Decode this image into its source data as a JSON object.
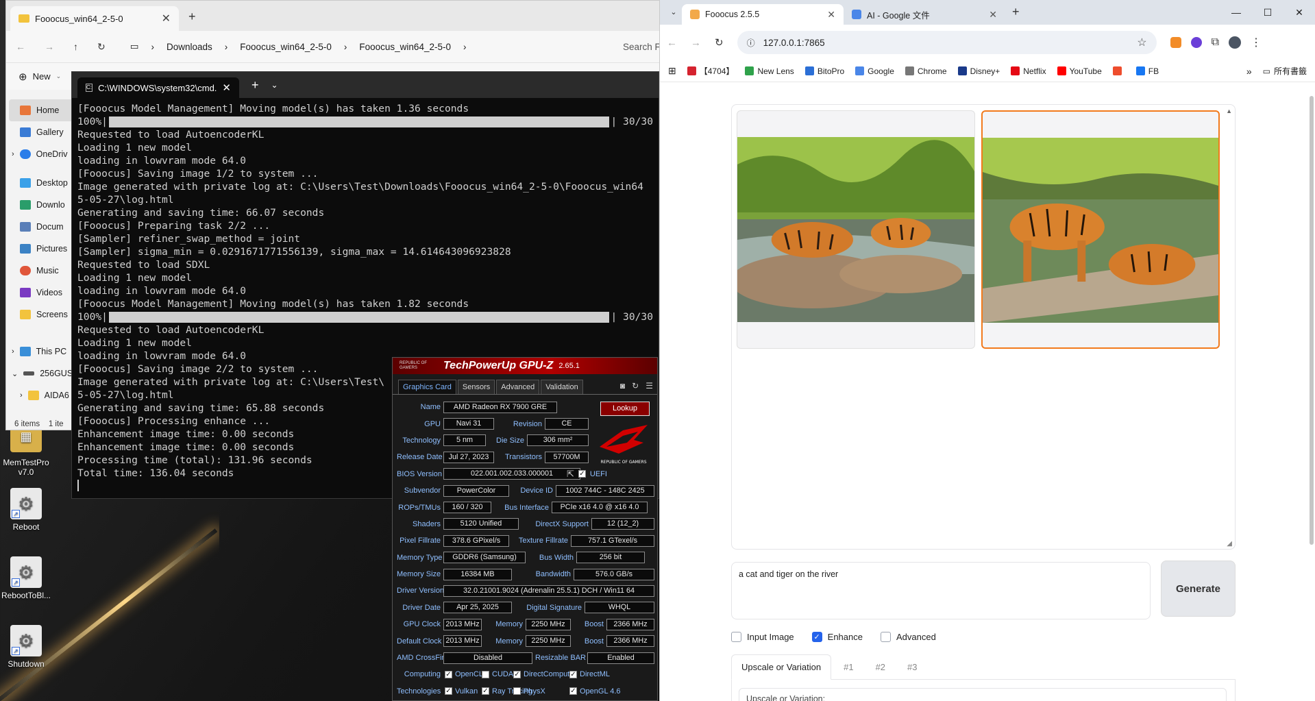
{
  "desktop": {
    "icons": [
      {
        "label": "MemTestPro v7.0"
      },
      {
        "label": "Reboot"
      },
      {
        "label": "RebootToBl..."
      },
      {
        "label": "Shutdown"
      }
    ]
  },
  "explorer": {
    "tab_title": "Fooocus_win64_2-5-0",
    "breadcrumbs": [
      "Downloads",
      "Fooocus_win64_2-5-0",
      "Fooocus_win64_2-5-0"
    ],
    "search_placeholder": "Search Foooc",
    "new_label": "New",
    "sidebar": [
      {
        "label": "Home",
        "color": "#e8763a"
      },
      {
        "label": "Gallery",
        "color": "#3a7bd5"
      },
      {
        "label": "OneDriv",
        "color": "#2b7de9"
      },
      {
        "label": "Desktop",
        "color": "#3aa0e8"
      },
      {
        "label": "Downlo",
        "color": "#2a9d6a"
      },
      {
        "label": "Docum",
        "color": "#5a7fb8"
      },
      {
        "label": "Pictures",
        "color": "#3b82c4"
      },
      {
        "label": "Music",
        "color": "#e0563a"
      },
      {
        "label": "Videos",
        "color": "#7a3ac2"
      },
      {
        "label": "Screens",
        "color": "#f2c33d"
      },
      {
        "label": "This PC",
        "color": "#3a8fd8"
      },
      {
        "label": "256GUS",
        "color": "#555555"
      },
      {
        "label": "AIDA6",
        "color": "#f2c33d"
      }
    ],
    "status": "6 items    1 ite"
  },
  "terminal": {
    "tab_title": "C:\\WINDOWS\\system32\\cmd.",
    "lines": [
      {
        "type": "text",
        "text": "[Fooocus Model Management] Moving model(s) has taken 1.36 seconds"
      },
      {
        "type": "bar",
        "prefix": "100%|",
        "suffix": "| 30/30"
      },
      {
        "type": "text",
        "text": "Requested to load AutoencoderKL"
      },
      {
        "type": "text",
        "text": "Loading 1 new model"
      },
      {
        "type": "text",
        "text": "loading in lowvram mode 64.0"
      },
      {
        "type": "text",
        "text": "[Fooocus] Saving image 1/2 to system ..."
      },
      {
        "type": "text",
        "text": "Image generated with private log at: C:\\Users\\Test\\Downloads\\Fooocus_win64_2-5-0\\Fooocus_win64"
      },
      {
        "type": "text",
        "text": "5-05-27\\log.html"
      },
      {
        "type": "text",
        "text": "Generating and saving time: 66.07 seconds"
      },
      {
        "type": "text",
        "text": "[Fooocus] Preparing task 2/2 ..."
      },
      {
        "type": "text",
        "text": "[Sampler] refiner_swap_method = joint"
      },
      {
        "type": "text",
        "text": "[Sampler] sigma_min = 0.0291671771556139, sigma_max = 14.614643096923828"
      },
      {
        "type": "text",
        "text": "Requested to load SDXL"
      },
      {
        "type": "text",
        "text": "Loading 1 new model"
      },
      {
        "type": "text",
        "text": "loading in lowvram mode 64.0"
      },
      {
        "type": "text",
        "text": "[Fooocus Model Management] Moving model(s) has taken 1.82 seconds"
      },
      {
        "type": "bar",
        "prefix": "100%|",
        "suffix": "| 30/30"
      },
      {
        "type": "text",
        "text": "Requested to load AutoencoderKL"
      },
      {
        "type": "text",
        "text": "Loading 1 new model"
      },
      {
        "type": "text",
        "text": "loading in lowvram mode 64.0"
      },
      {
        "type": "text",
        "text": "[Fooocus] Saving image 2/2 to system ..."
      },
      {
        "type": "text",
        "text": "Image generated with private log at: C:\\Users\\Test\\"
      },
      {
        "type": "text",
        "text": "5-05-27\\log.html"
      },
      {
        "type": "text",
        "text": "Generating and saving time: 65.88 seconds"
      },
      {
        "type": "text",
        "text": "[Fooocus] Processing enhance ..."
      },
      {
        "type": "text",
        "text": "Enhancement image time: 0.00 seconds"
      },
      {
        "type": "text",
        "text": "Enhancement image time: 0.00 seconds"
      },
      {
        "type": "text",
        "text": "Processing time (total): 131.96 seconds"
      },
      {
        "type": "text",
        "text": "Total time: 136.04 seconds"
      }
    ]
  },
  "gpuz": {
    "title_rog": "REPUBLIC OF GAMERS",
    "title": "TechPowerUp GPU-Z",
    "version": "2.65.1",
    "tabs": [
      "Graphics Card",
      "Sensors",
      "Advanced",
      "Validation"
    ],
    "lookup_label": "Lookup",
    "logo_text": "REPUBLIC OF GAMERS",
    "name": "AMD Radeon RX 7900 GRE",
    "gpu": "Navi 31",
    "revision": "CE",
    "technology": "5 nm",
    "die_size": "306 mm²",
    "release_date": "Jul 27, 2023",
    "transistors": "57700M",
    "bios_version": "022.001.002.033.000001",
    "uefi_label": "UEFI",
    "subvendor": "PowerColor",
    "device_id": "1002 744C - 148C 2425",
    "rops_tmus": "160 / 320",
    "bus_interface": "PCIe x16 4.0 @ x16 4.0",
    "shaders": "5120 Unified",
    "directx": "12 (12_2)",
    "pixel_fillrate": "378.6 GPixel/s",
    "texture_fillrate": "757.1 GTexel/s",
    "memory_type": "GDDR6 (Samsung)",
    "bus_width": "256 bit",
    "memory_size": "16384 MB",
    "bandwidth": "576.0 GB/s",
    "driver_version": "32.0.21001.9024 (Adrenalin 25.5.1) DCH / Win11 64",
    "driver_date": "Apr 25, 2025",
    "digital_signature": "WHQL",
    "gpu_clock": "2013 MHz",
    "memory_clock": "2250 MHz",
    "boost": "2366 MHz",
    "default_clock": "2013 MHz",
    "default_memory": "2250 MHz",
    "default_boost": "2366 MHz",
    "crossfire": "Disabled",
    "resizable_bar": "Enabled",
    "labels": {
      "name": "Name",
      "gpu": "GPU",
      "revision": "Revision",
      "technology": "Technology",
      "die_size": "Die Size",
      "release_date": "Release Date",
      "transistors": "Transistors",
      "bios": "BIOS Version",
      "subvendor": "Subvendor",
      "device_id": "Device ID",
      "rops": "ROPs/TMUs",
      "bus": "Bus Interface",
      "shaders": "Shaders",
      "directx": "DirectX Support",
      "pixel": "Pixel Fillrate",
      "texture": "Texture Fillrate",
      "memtype": "Memory Type",
      "buswidth": "Bus Width",
      "memsize": "Memory Size",
      "bandwidth": "Bandwidth",
      "driver": "Driver Version",
      "driver_date": "Driver Date",
      "signature": "Digital Signature",
      "gpu_clock": "GPU Clock",
      "memory": "Memory",
      "boost": "Boost",
      "default_clock": "Default Clock",
      "crossfire": "AMD CrossFire",
      "rebar": "Resizable BAR",
      "computing": "Computing",
      "technologies": "Technologies"
    },
    "computing": [
      "OpenCL",
      "CUDA",
      "DirectCompute",
      "DirectML"
    ],
    "computing_checked": [
      true,
      false,
      true,
      true
    ],
    "technologies": [
      "Vulkan",
      "Ray Tracing",
      "PhysX",
      "OpenGL 4.6"
    ],
    "technologies_checked": [
      true,
      true,
      false,
      true
    ]
  },
  "browser": {
    "tabs": [
      {
        "title": "Fooocus 2.5.5",
        "color": "#f2a94a"
      },
      {
        "title": "AI - Google 文件",
        "color": "#4a86e8"
      }
    ],
    "url": "127.0.0.1:7865",
    "bookmarks": [
      {
        "label": "【4704】",
        "color": "#d5232f"
      },
      {
        "label": "New Lens",
        "color": "#2fa24b"
      },
      {
        "label": "BitoPro",
        "color": "#2b6fd6"
      },
      {
        "label": "Google",
        "color": "#4a86e8"
      },
      {
        "label": "Chrome",
        "color": "#777777"
      },
      {
        "label": "Disney+",
        "color": "#1a3a8a"
      },
      {
        "label": "Netflix",
        "color": "#e50914"
      },
      {
        "label": "YouTube",
        "color": "#ff0000"
      },
      {
        "label": "",
        "color": "#ee4d2d"
      },
      {
        "label": "FB",
        "color": "#1877f2"
      }
    ],
    "all_bookmarks": "所有書籤"
  },
  "fooocus": {
    "prompt": "a cat and tiger on the river",
    "generate_label": "Generate",
    "options": [
      {
        "label": "Input Image",
        "checked": false
      },
      {
        "label": "Enhance",
        "checked": true
      },
      {
        "label": "Advanced",
        "checked": false
      }
    ],
    "enhance_tabs": [
      "Upscale or Variation",
      "#1",
      "#2",
      "#3"
    ],
    "upscale_field_label": "Upscale or Variation:",
    "accent_color": "#f27a1c",
    "checkbox_color": "#2563eb"
  }
}
